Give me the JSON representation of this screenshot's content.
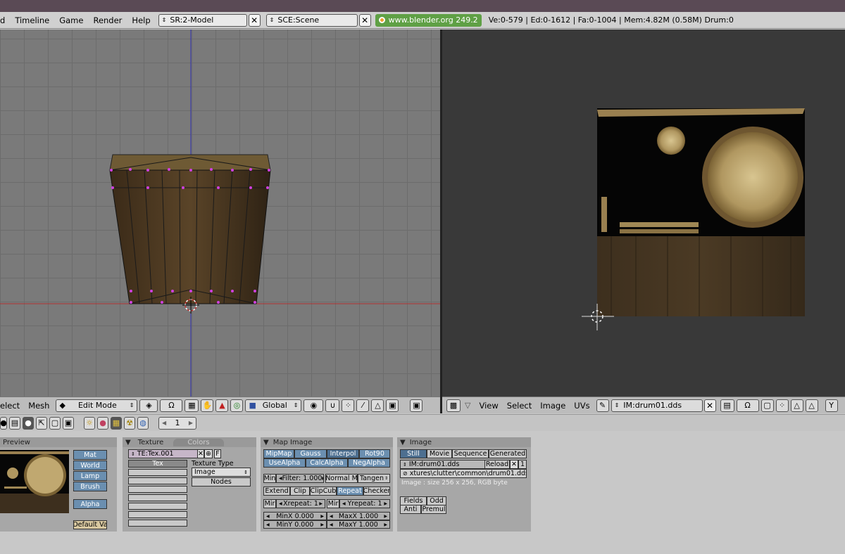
{
  "topbar": {
    "menus": [
      "d",
      "Timeline",
      "Game",
      "Render",
      "Help"
    ],
    "screen_field": "SR:2-Model",
    "scene_field": "SCE:Scene",
    "url": "www.blender.org 249.2",
    "stats": "Ve:0-579 | Ed:0-1612 | Fa:0-1004 | Mem:4.82M (0.58M) Drum:0"
  },
  "header3d": {
    "menus": [
      "elect",
      "Mesh"
    ],
    "mode": "Edit Mode",
    "orientation": "Global"
  },
  "headerimg": {
    "menus": [
      "View",
      "Select",
      "Image",
      "UVs"
    ],
    "image_field": "IM:drum01.dds"
  },
  "tabrow": {
    "frame": "1"
  },
  "preview_panel": {
    "title": "Preview",
    "buttons": [
      "Mat",
      "World",
      "Lamp",
      "Brush"
    ],
    "alpha": "Alpha",
    "default": "Default Va"
  },
  "texture_panel": {
    "tab_texture": "Texture",
    "tab_colors": "Colors",
    "tex_field": "TE:Tex.001",
    "f_btn": "F",
    "tex_label": "Tex",
    "type_label": "Texture Type",
    "type_value": "Image",
    "nodes": "Nodes"
  },
  "mapimage_panel": {
    "title": "Map Image",
    "row1": [
      "MipMap",
      "Gauss",
      "Interpol",
      "Rot90"
    ],
    "row2": [
      "UseAlpha",
      "CalcAlpha",
      "NegAlpha"
    ],
    "min": "Min",
    "filter": "Filter: 1.000",
    "normal_map": "Normal M",
    "tangent": "Tangen",
    "row4": [
      "Extend",
      "Clip",
      "ClipCub",
      "Repeat",
      "Checker"
    ],
    "mir1": "Mir",
    "xrepeat": "Xrepeat: 1",
    "mir2": "Mir",
    "yrepeat": "Yrepeat: 1",
    "minx": "MinX 0.000",
    "maxx": "MaxX 1.000",
    "miny": "MinY 0.000",
    "maxy": "MaxY 1.000"
  },
  "image_panel": {
    "title": "Image",
    "row1": [
      "Still",
      "Movie",
      "Sequence",
      "Generated"
    ],
    "im_field": "IM:drum01.dds",
    "reload": "Reload",
    "users": "1",
    "path": "xtures\\clutter\\common\\drum01.dds",
    "info": "Image : size 256 x 256, RGB byte",
    "fields": "Fields",
    "odd": "Odd",
    "anti": "Anti",
    "premul": "Premul"
  },
  "colors": {
    "vertex": "#d040e0",
    "grid_x": "#b03030",
    "grid_y": "#3030b0",
    "url_bg": "#5fa045"
  }
}
